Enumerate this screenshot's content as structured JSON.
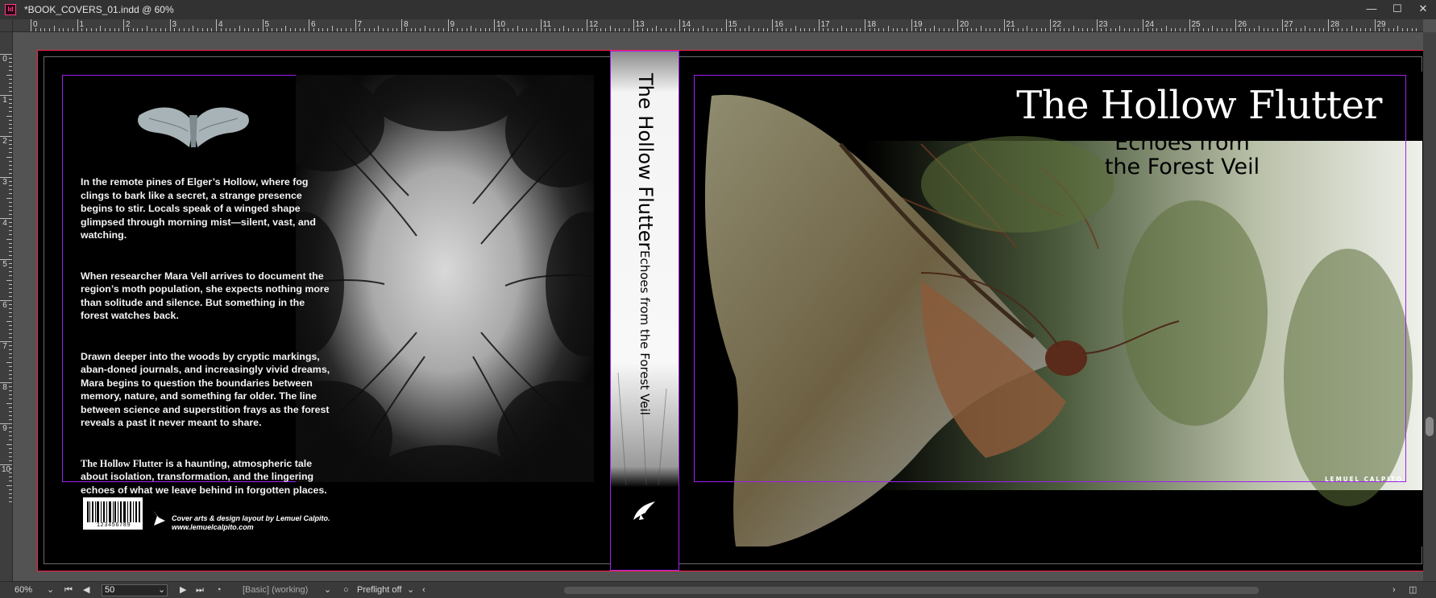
{
  "window": {
    "title": "*BOOK_COVERS_01.indd @ 60%",
    "app_icon_label": "Id",
    "minimize": "—",
    "maximize": "☐",
    "close": "✕"
  },
  "rulers": {
    "horizontal": [
      "0",
      "1",
      "2",
      "3",
      "4",
      "5",
      "6",
      "7",
      "8",
      "9",
      "10",
      "11",
      "12",
      "13",
      "14",
      "15",
      "16",
      "17",
      "18",
      "19",
      "20",
      "21",
      "22",
      "23",
      "24",
      "25",
      "26",
      "27",
      "28",
      "29"
    ],
    "vertical": [
      "0",
      "1",
      "2",
      "3",
      "4",
      "5",
      "6",
      "7",
      "8",
      "9",
      "10"
    ]
  },
  "back_cover": {
    "paragraphs": [
      {
        "lead": "",
        "text": "In the remote pines of Elger’s Hollow, where fog clings to bark like a secret, a strange presence begins to stir. Locals speak of a winged shape glimpsed through morning mist—silent, vast, and watching."
      },
      {
        "lead": "",
        "text": "When researcher Mara Vell arrives to document the region’s moth population, she expects nothing more than solitude and silence. But something in the forest watches back."
      },
      {
        "lead": "",
        "text": "Drawn deeper into the woods by cryptic markings, aban-doned journals, and increasingly vivid dreams, Mara begins to question the boundaries between memory, nature, and something far older. The line between science and superstition frays as the forest reveals a past it never meant to share."
      },
      {
        "lead": "The Hollow Flutter",
        "text": " is a haunting, atmospheric tale about isolation, transformation, and the lingering echoes of what we leave behind in forgotten places."
      }
    ],
    "barcode_number": "123456789",
    "credit_line1": "Cover arts & design layout by Lemuel Calpito.",
    "credit_line2": "www.lemuelcalpito.com"
  },
  "spine": {
    "title": "The Hollow Flutter",
    "subtitle": "Echoes from the Forest Veil"
  },
  "front_cover": {
    "title": "The Hollow Flutter",
    "subtitle_line1": "Echoes from",
    "subtitle_line2": "the Forest Veil",
    "author": "LEMUEL CALPITO"
  },
  "status_bar": {
    "zoom": "60%",
    "page": "50",
    "master": "[Basic] (working)",
    "preflight": "Preflight off"
  }
}
